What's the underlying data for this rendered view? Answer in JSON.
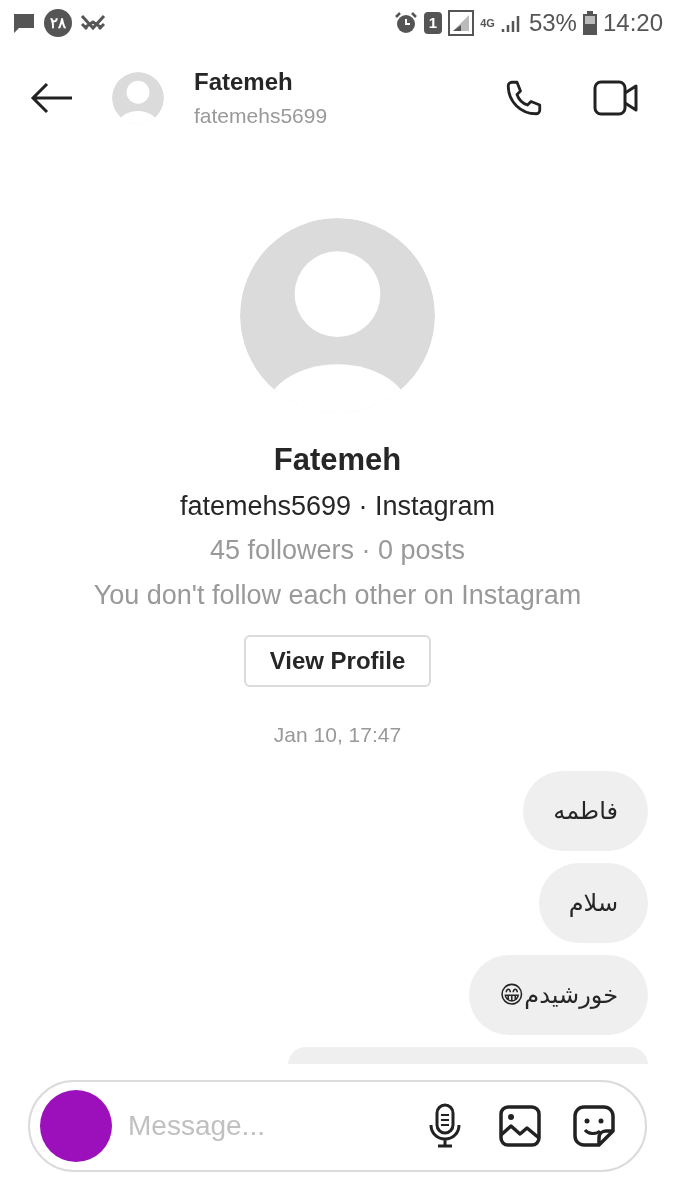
{
  "status_bar": {
    "left_badge": "۲۸",
    "sim": "1",
    "network": "4G",
    "battery": "53%",
    "time": "14:20"
  },
  "header": {
    "name": "Fatemeh",
    "username": "fatemehs5699"
  },
  "profile": {
    "name": "Fatemeh",
    "subtitle": "fatemehs5699 · Instagram",
    "stats": "45 followers · 0 posts",
    "note": "You don't follow each other on Instagram",
    "button": "View Profile"
  },
  "timestamp": "Jan 10, 17:47",
  "messages": [
    {
      "text": "فاطمه"
    },
    {
      "text": "سلام"
    },
    {
      "text": "خورشیدم😁"
    }
  ],
  "composer": {
    "placeholder": "Message..."
  }
}
